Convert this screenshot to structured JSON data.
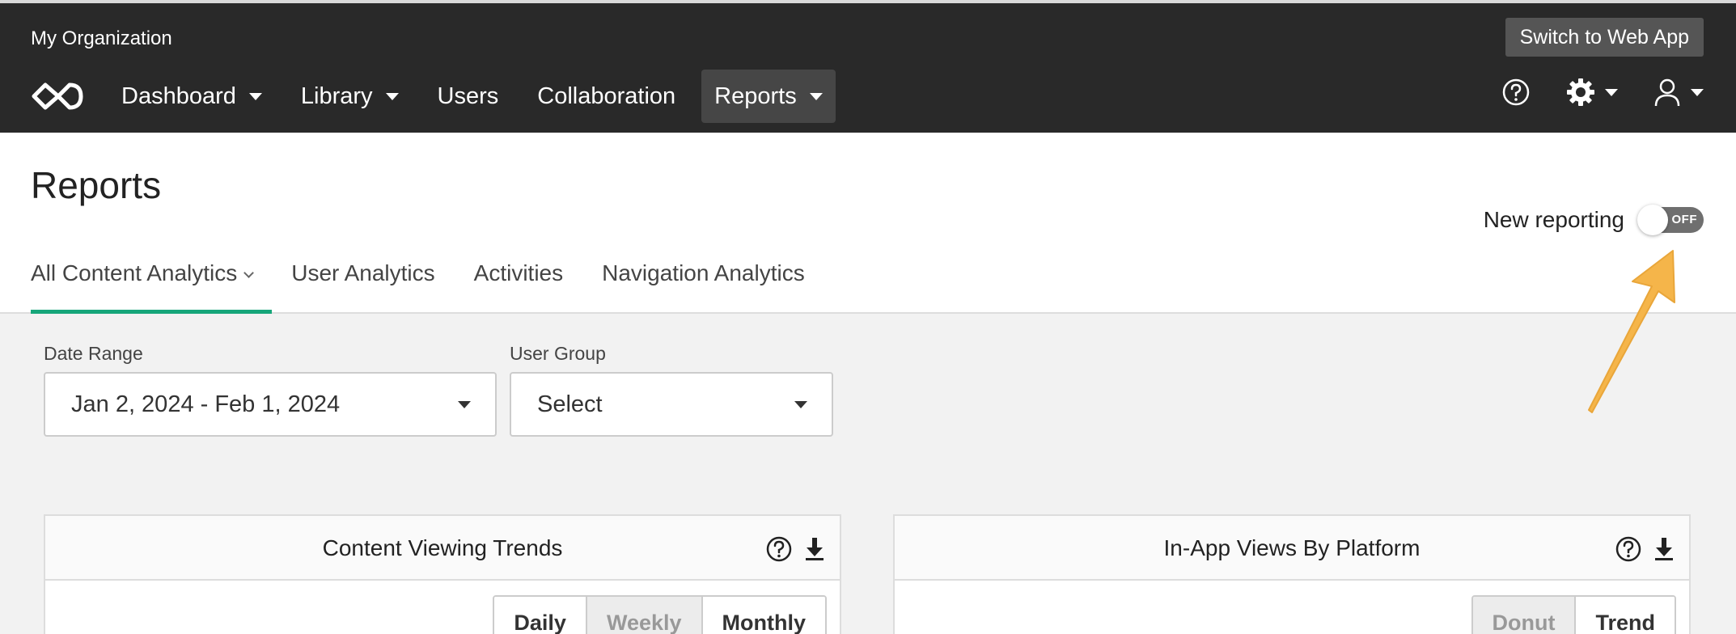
{
  "topbar": {
    "org_name": "My Organization",
    "switch_label": "Switch to Web App",
    "nav": [
      {
        "label": "Dashboard"
      },
      {
        "label": "Library"
      },
      {
        "label": "Users"
      },
      {
        "label": "Collaboration"
      },
      {
        "label": "Reports"
      }
    ],
    "icons": [
      "help-icon",
      "settings-icon",
      "user-icon"
    ]
  },
  "header": {
    "title": "Reports",
    "new_reporting_label": "New reporting",
    "toggle_state": "OFF",
    "tabs": [
      {
        "label": "All Content Analytics"
      },
      {
        "label": "User Analytics"
      },
      {
        "label": "Activities"
      },
      {
        "label": "Navigation Analytics"
      }
    ]
  },
  "filters": {
    "date_range_label": "Date Range",
    "date_range_value": "Jan 2, 2024 - Feb 1, 2024",
    "user_group_label": "User Group",
    "user_group_value": "Select"
  },
  "cards": [
    {
      "title": "Content Viewing Trends",
      "buttons": [
        "Daily",
        "Weekly",
        "Monthly"
      ],
      "selected": "Weekly"
    },
    {
      "title": "In-App Views By Platform",
      "buttons": [
        "Donut",
        "Trend"
      ],
      "selected": "Donut"
    }
  ],
  "colors": {
    "topbar_bg": "#292929",
    "active_tab_underline": "#17a67a",
    "annotation_arrow": "#f5b54a"
  }
}
